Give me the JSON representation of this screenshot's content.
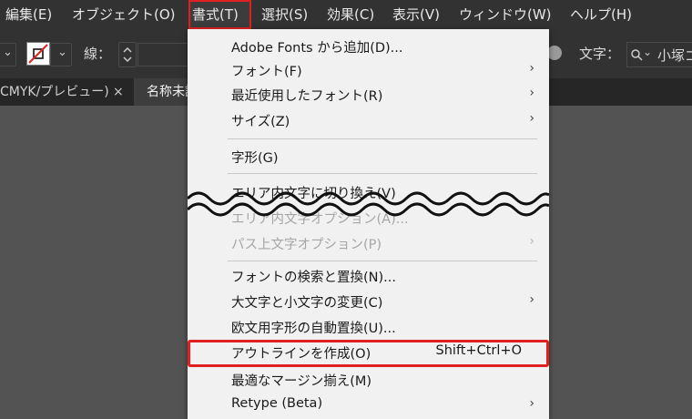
{
  "menubar": {
    "items": [
      "編集(E)",
      "オブジェクト(O)",
      "書式(T)",
      "選択(S)",
      "効果(C)",
      "表示(V)",
      "ウィンドウ(W)",
      "ヘルプ(H)"
    ]
  },
  "toolbar": {
    "stroke_label": "線：",
    "text_label": "文字：",
    "font_value": "小塚ゴ"
  },
  "tabs": {
    "first": "CMYK/プレビュー)",
    "close": "×",
    "second": "名称未設"
  },
  "menu": {
    "items": [
      {
        "label": "Adobe Fonts から追加(D)..."
      },
      {
        "label": "フォント(F)"
      },
      {
        "label": "最近使用したフォント(R)"
      },
      {
        "label": "サイズ(Z)"
      },
      {
        "label": "字形(G)"
      },
      {
        "label": "エリア内文字に切り換え(V)"
      },
      {
        "label": "エリア内文字オプション(A)..."
      },
      {
        "label": "パス上文字オプション(P)"
      },
      {
        "label": "フォントの検索と置換(N)..."
      },
      {
        "label": "大文字と小文字の変更(C)"
      },
      {
        "label": "欧文用字形の自動置換(U)..."
      },
      {
        "label": "アウトラインを作成(O)",
        "shortcut": "Shift+Ctrl+O"
      },
      {
        "label": "最適なマージン揃え(M)"
      },
      {
        "label": "Retype (Beta)"
      }
    ],
    "submenu_arrow": "›"
  },
  "colors": {
    "menu_bg": "#f1f1f1",
    "app_bg": "#323232",
    "highlight_border": "#e02020"
  }
}
